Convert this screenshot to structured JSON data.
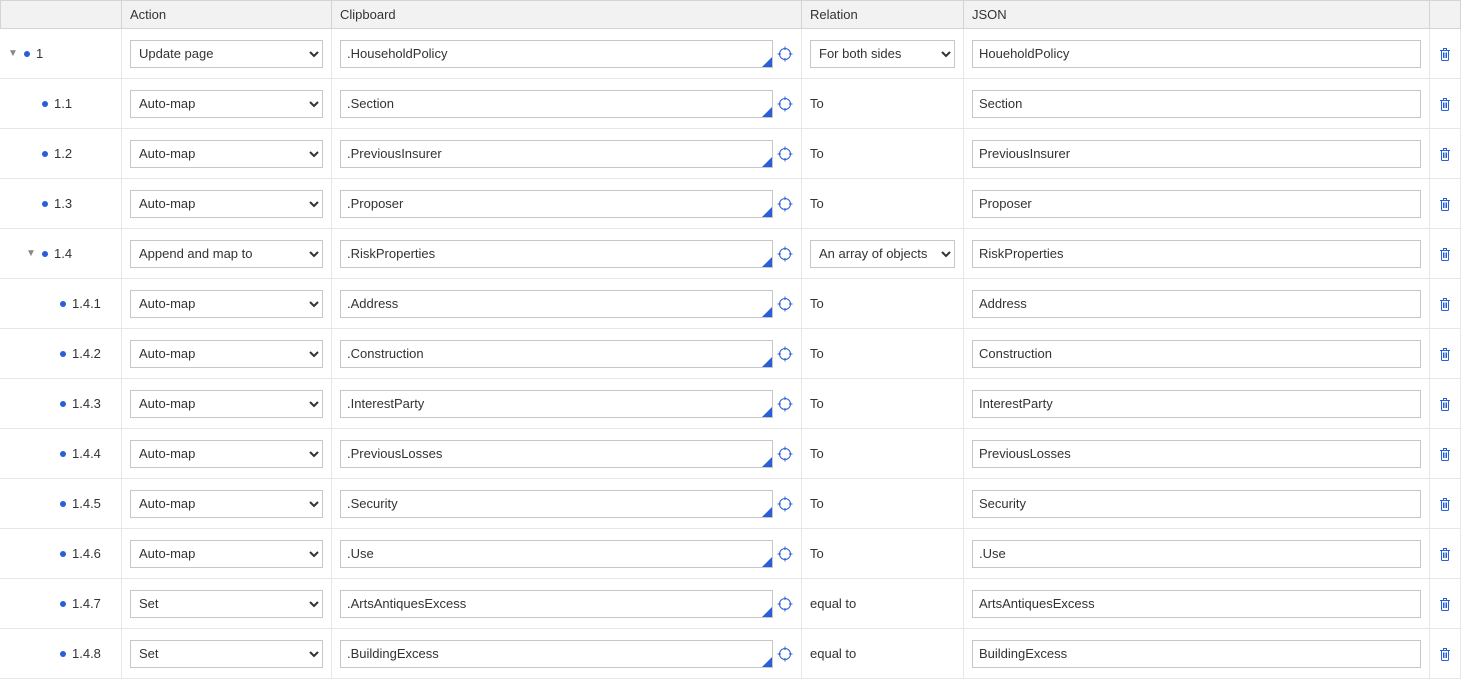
{
  "headers": {
    "tree": "",
    "action": "Action",
    "clipboard": "Clipboard",
    "relation": "Relation",
    "json": "JSON",
    "actions": ""
  },
  "rows": [
    {
      "indent": 0,
      "expandable": true,
      "expanded": true,
      "num": "1",
      "action": "Update page",
      "clipboard": ".HouseholdPolicy",
      "relation_type": "select",
      "relation": "For both sides",
      "json": "HoueholdPolicy"
    },
    {
      "indent": 1,
      "expandable": false,
      "expanded": false,
      "num": "1.1",
      "action": "Auto-map",
      "clipboard": ".Section",
      "relation_type": "text",
      "relation": "To",
      "json": "Section"
    },
    {
      "indent": 1,
      "expandable": false,
      "expanded": false,
      "num": "1.2",
      "action": "Auto-map",
      "clipboard": ".PreviousInsurer",
      "relation_type": "text",
      "relation": "To",
      "json": "PreviousInsurer"
    },
    {
      "indent": 1,
      "expandable": false,
      "expanded": false,
      "num": "1.3",
      "action": "Auto-map",
      "clipboard": ".Proposer",
      "relation_type": "text",
      "relation": "To",
      "json": "Proposer"
    },
    {
      "indent": 1,
      "expandable": true,
      "expanded": true,
      "num": "1.4",
      "action": "Append and map to",
      "clipboard": ".RiskProperties",
      "relation_type": "select",
      "relation": "An array of objects",
      "json": "RiskProperties"
    },
    {
      "indent": 2,
      "expandable": false,
      "expanded": false,
      "num": "1.4.1",
      "action": "Auto-map",
      "clipboard": ".Address",
      "relation_type": "text",
      "relation": "To",
      "json": "Address"
    },
    {
      "indent": 2,
      "expandable": false,
      "expanded": false,
      "num": "1.4.2",
      "action": "Auto-map",
      "clipboard": ".Construction",
      "relation_type": "text",
      "relation": "To",
      "json": "Construction"
    },
    {
      "indent": 2,
      "expandable": false,
      "expanded": false,
      "num": "1.4.3",
      "action": "Auto-map",
      "clipboard": ".InterestParty",
      "relation_type": "text",
      "relation": "To",
      "json": "InterestParty"
    },
    {
      "indent": 2,
      "expandable": false,
      "expanded": false,
      "num": "1.4.4",
      "action": "Auto-map",
      "clipboard": ".PreviousLosses",
      "relation_type": "text",
      "relation": "To",
      "json": "PreviousLosses"
    },
    {
      "indent": 2,
      "expandable": false,
      "expanded": false,
      "num": "1.4.5",
      "action": "Auto-map",
      "clipboard": ".Security",
      "relation_type": "text",
      "relation": "To",
      "json": "Security"
    },
    {
      "indent": 2,
      "expandable": false,
      "expanded": false,
      "num": "1.4.6",
      "action": "Auto-map",
      "clipboard": ".Use",
      "relation_type": "text",
      "relation": "To",
      "json": ".Use"
    },
    {
      "indent": 2,
      "expandable": false,
      "expanded": false,
      "num": "1.4.7",
      "action": "Set",
      "clipboard": ".ArtsAntiquesExcess",
      "relation_type": "text",
      "relation": "equal to",
      "json": "ArtsAntiquesExcess"
    },
    {
      "indent": 2,
      "expandable": false,
      "expanded": false,
      "num": "1.4.8",
      "action": "Set",
      "clipboard": ".BuildingExcess",
      "relation_type": "text",
      "relation": "equal to",
      "json": "BuildingExcess"
    }
  ]
}
